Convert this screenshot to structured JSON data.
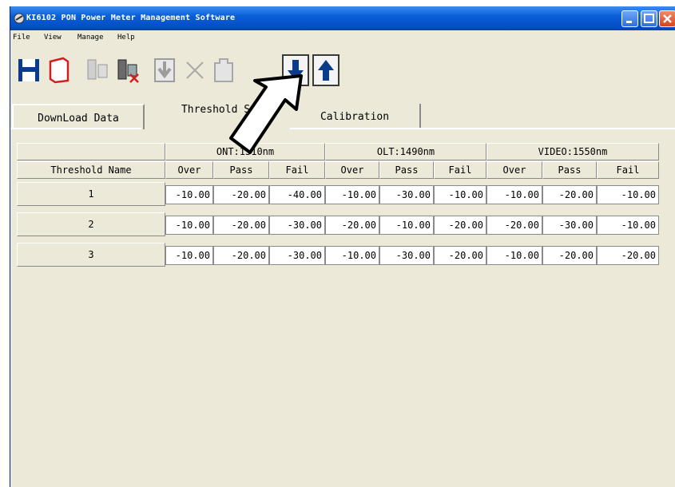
{
  "window": {
    "title": "KI6102 PON Power Meter Management Software",
    "titlebar_color": "#0a5fd8"
  },
  "menu": [
    "File",
    "View",
    "Manage",
    "Help"
  ],
  "toolbar": {
    "buttons": [
      "save-icon",
      "open-icon",
      "devices-icon",
      "disconnect-icon",
      "check-download-icon",
      "delete-icon",
      "clear-icon",
      "download-arrow-icon",
      "upload-arrow-icon"
    ]
  },
  "tabs": [
    "DownLoad Data",
    "Threshold S",
    "Calibration"
  ],
  "table": {
    "groups": [
      "ONT:1310nm",
      "OLT:1490nm",
      "VIDEO:1550nm"
    ],
    "columns": [
      "Threshold Name",
      "Over",
      "Pass",
      "Fail",
      "Over",
      "Pass",
      "Fail",
      "Over",
      "Pass",
      "Fail"
    ],
    "rows": [
      {
        "name": "1",
        "values": [
          "-10.00",
          "-20.00",
          "-40.00",
          "-10.00",
          "-30.00",
          "-10.00",
          "-10.00",
          "-20.00",
          "-10.00"
        ]
      },
      {
        "name": "2",
        "values": [
          "-10.00",
          "-20.00",
          "-30.00",
          "-20.00",
          "-10.00",
          "-20.00",
          "-20.00",
          "-30.00",
          "-10.00"
        ]
      },
      {
        "name": "3",
        "values": [
          "-10.00",
          "-20.00",
          "-30.00",
          "-10.00",
          "-30.00",
          "-20.00",
          "-10.00",
          "-20.00",
          "-20.00"
        ]
      }
    ]
  },
  "colors": {
    "accent": "#0a246a",
    "icon_blue": "#0b3c8c",
    "icon_red": "#d01f1f"
  }
}
